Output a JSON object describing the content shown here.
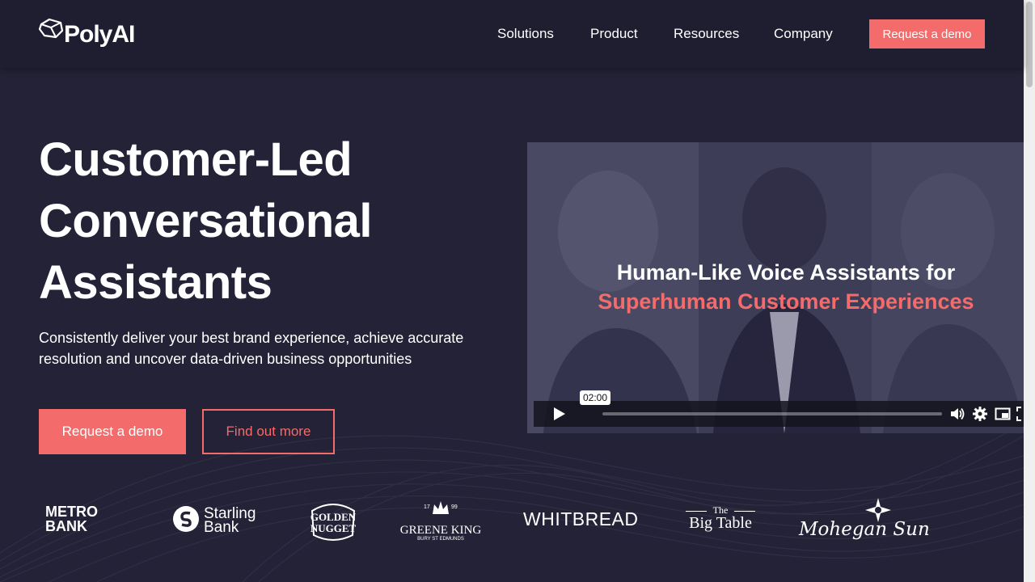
{
  "header": {
    "logo_text": "PolyAI",
    "nav": [
      "Solutions",
      "Product",
      "Resources",
      "Company"
    ],
    "cta_label": "Request a demo"
  },
  "hero": {
    "title_lines": [
      "Customer-Led",
      "Conversational",
      "Assistants"
    ],
    "subtitle": "Consistently deliver your best brand experience, achieve accurate resolution and uncover data-driven business opportunities",
    "primary_button": "Request a demo",
    "secondary_button": "Find out more"
  },
  "video": {
    "title_line1": "Human-Like Voice Assistants for",
    "title_line2": "Superhuman Customer Experiences",
    "time": "02:00"
  },
  "brands": {
    "metro": "METRO BANK",
    "starling_1": "Starling",
    "starling_2": "Bank",
    "golden_1": "GOLDEN",
    "golden_2": "NUGGET",
    "greene": "GREENE KING",
    "greene_sub": "BURY ST EDMUNDS",
    "greene_year_left": "17",
    "greene_year_right": "99",
    "whitbread": "WHITBREAD",
    "bigtable_top": "The",
    "bigtable_main": "Big Table",
    "mohegan": "Mohegan Sun"
  },
  "colors": {
    "accent": "#f46b6b",
    "background": "#232236",
    "header_bg": "#1f1e31"
  }
}
